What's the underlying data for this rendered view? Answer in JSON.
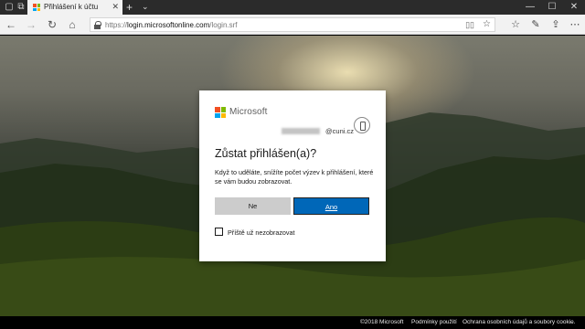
{
  "browser": {
    "tab_title": "Přihlášení k účtu",
    "url_prefix": "https://",
    "url_host": "login.microsoftonline.com",
    "url_path": "/login.srf",
    "new_tab_glyph": "+",
    "tab_close_glyph": "✕"
  },
  "dialog": {
    "brand": "Microsoft",
    "account_email_suffix": "@cuni.cz",
    "heading": "Zůstat přihlášen(a)?",
    "description": "Když to uděláte, snížíte počet výzev k přihlášení, které se vám budou zobrazovat.",
    "no_label": "Ne",
    "yes_label": "Ano",
    "checkbox_label": "Příště už nezobrazovat",
    "checkbox_checked": false
  },
  "footer": {
    "copyright": "©2018 Microsoft",
    "terms": "Podmínky použití",
    "privacy": "Ochrana osobních údajů a soubory cookie",
    "more": "..."
  },
  "colors": {
    "ms_red": "#f25022",
    "ms_green": "#7fba00",
    "ms_blue": "#00a4ef",
    "ms_yellow": "#ffb900",
    "primary_button": "#0067b8"
  },
  "icons": [
    "back-arrow-icon",
    "forward-arrow-icon",
    "refresh-icon",
    "home-icon",
    "lock-icon",
    "reading-view-icon",
    "favorite-star-icon",
    "favorites-hub-icon",
    "pen-icon",
    "share-icon",
    "more-icon",
    "minimize-icon",
    "maximize-icon",
    "close-icon",
    "account-badge-icon"
  ]
}
